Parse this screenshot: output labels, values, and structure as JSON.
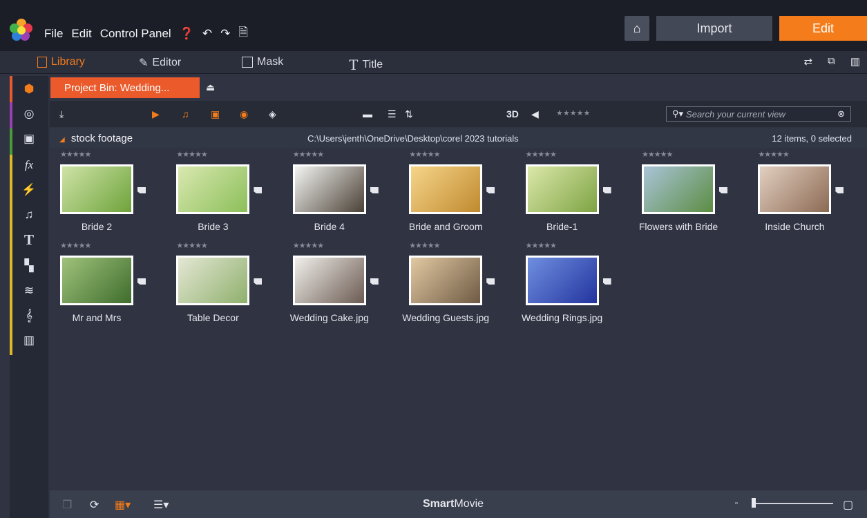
{
  "top": {
    "menu": [
      "File",
      "Edit",
      "Control Panel"
    ],
    "import_label": "Import",
    "edit_label": "Edit"
  },
  "tabs": [
    {
      "label": "Library",
      "active": true
    },
    {
      "label": "Editor"
    },
    {
      "label": "Mask"
    },
    {
      "label": "Title"
    }
  ],
  "bin": {
    "title": "Project Bin: Wedding..."
  },
  "toolbar": {
    "label_3d": "3D",
    "search_placeholder": "Search your current view"
  },
  "folder": {
    "name": "stock footage",
    "path": "C:\\Users\\jenth\\OneDrive\\Desktop\\corel 2023 tutorials",
    "count": "12 items, 0 selected"
  },
  "items": [
    {
      "name": "Bride 2",
      "colors": [
        "#cfe3a7",
        "#6ea33b"
      ]
    },
    {
      "name": "Bride 3",
      "colors": [
        "#d9e8b0",
        "#8cbf5a"
      ]
    },
    {
      "name": "Bride 4",
      "colors": [
        "#f3f4f2",
        "#4b4136"
      ]
    },
    {
      "name": "Bride and Groom",
      "colors": [
        "#f6d58a",
        "#c08a2f"
      ]
    },
    {
      "name": "Bride-1",
      "colors": [
        "#dbe8a9",
        "#7ea344"
      ]
    },
    {
      "name": "Flowers with Bride",
      "colors": [
        "#a9c4d8",
        "#5c8d43"
      ]
    },
    {
      "name": "Inside Church",
      "colors": [
        "#e2cfc0",
        "#8c6a54"
      ]
    },
    {
      "name": "Mr and Mrs",
      "colors": [
        "#9fc27b",
        "#3f6d2d"
      ]
    },
    {
      "name": "Table Decor",
      "colors": [
        "#e4e7d4",
        "#8fb06d"
      ]
    },
    {
      "name": "Wedding Cake.jpg",
      "colors": [
        "#f1efeb",
        "#6b5b52"
      ]
    },
    {
      "name": "Wedding Guests.jpg",
      "colors": [
        "#e2c9a3",
        "#6f5a44"
      ]
    },
    {
      "name": "Wedding Rings.jpg",
      "colors": [
        "#6f8fe0",
        "#23349e"
      ]
    }
  ],
  "rating_placeholder": "★★★★★",
  "bottom": {
    "smart_bold": "Smart",
    "smart_rest": "Movie"
  },
  "colors": {
    "accent": "#f47c1a",
    "bin_tab": "#ea5a2b"
  }
}
